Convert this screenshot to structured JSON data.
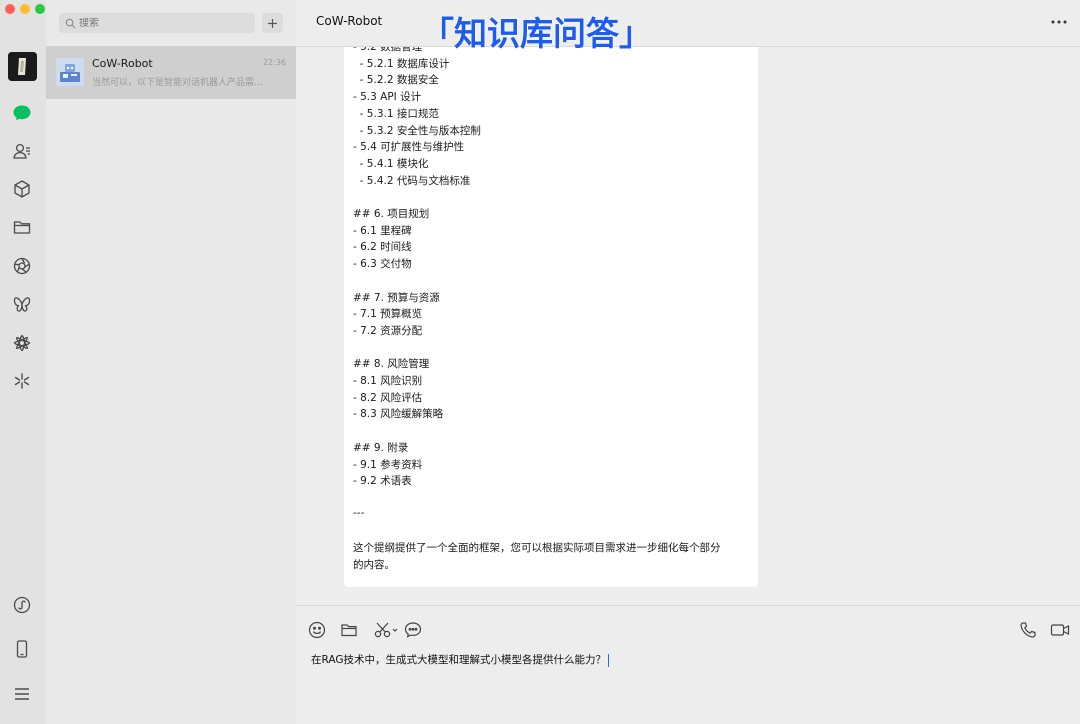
{
  "window": {
    "controls": [
      {
        "name": "close",
        "color": "#fe5f57"
      },
      {
        "name": "minimize",
        "color": "#febc2e"
      },
      {
        "name": "zoom",
        "color": "#28c840"
      }
    ]
  },
  "sidebar": {
    "accent": "#07c160",
    "items": [
      {
        "icon": "chat-icon",
        "active": true
      },
      {
        "icon": "contacts-icon"
      },
      {
        "icon": "cube-icon"
      },
      {
        "icon": "folder-icon"
      },
      {
        "icon": "aperture-icon"
      },
      {
        "icon": "butterfly-icon"
      },
      {
        "icon": "settings-flower-icon"
      },
      {
        "icon": "sparkle-icon"
      }
    ],
    "bottom_items": [
      {
        "icon": "mini-program-icon"
      },
      {
        "icon": "phone-device-icon"
      },
      {
        "icon": "menu-icon"
      }
    ]
  },
  "chatlist": {
    "search_placeholder": "搜索",
    "conversations": [
      {
        "name": "CoW-Robot",
        "time": "22:36",
        "preview": "当然可以，以下是智能对话机器人产品需…"
      }
    ]
  },
  "header": {
    "title": "CoW-Robot",
    "overlay": "「知识库问答」"
  },
  "message": {
    "lines": [
      "- 5.2 数据管理",
      "  - 5.2.1 数据库设计",
      "  - 5.2.2 数据安全",
      "- 5.3 API 设计",
      "  - 5.3.1 接口规范",
      "  - 5.3.2 安全性与版本控制",
      "- 5.4 可扩展性与维护性",
      "  - 5.4.1 模块化",
      "  - 5.4.2 代码与文档标准",
      "",
      "## 6. 项目规划",
      "- 6.1 里程碑",
      "- 6.2 时间线",
      "- 6.3 交付物",
      "",
      "## 7. 预算与资源",
      "- 7.1 预算概览",
      "- 7.2 资源分配",
      "",
      "## 8. 风险管理",
      "- 8.1 风险识别",
      "- 8.2 风险评估",
      "- 8.3 风险缓解策略",
      "",
      "## 9. 附录",
      "- 9.1 参考资料",
      "- 9.2 术语表",
      "",
      "---",
      "",
      "这个提纲提供了一个全面的框架，您可以根据实际项目需求进一步细化每个部分",
      "的内容。"
    ]
  },
  "composer": {
    "tools": [
      "emoji-icon",
      "folder-icon",
      "scissors-icon",
      "chat-bubble-icon"
    ],
    "right_tools": [
      "phone-icon",
      "video-icon"
    ],
    "input_value": "在RAG技术中，生成式大模型和理解式小模型各提供什么能力？"
  }
}
